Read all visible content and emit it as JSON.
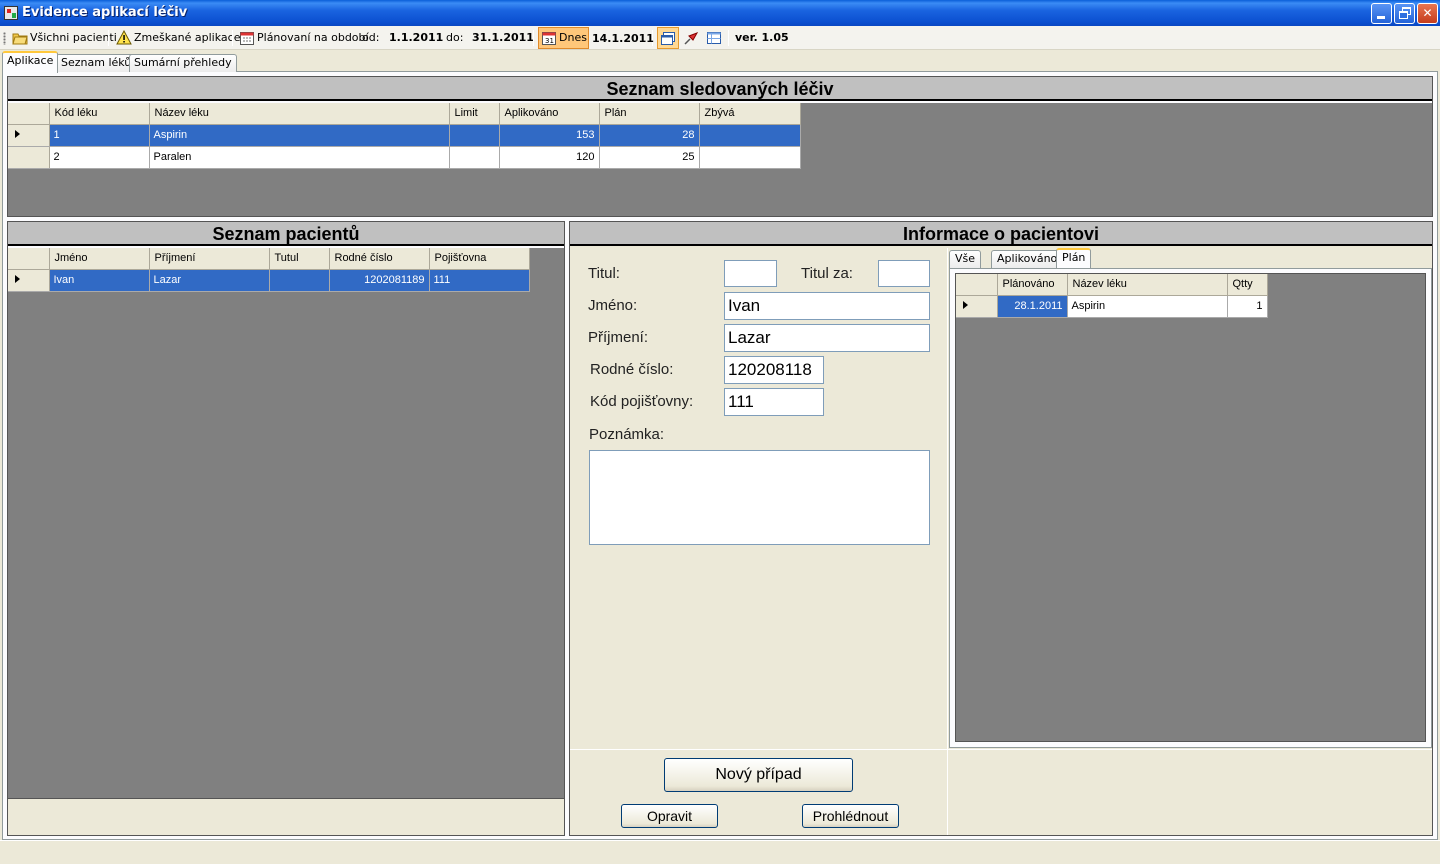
{
  "window": {
    "title": "Evidence aplikací léčiv"
  },
  "toolbar": {
    "all_patients": "Všichni pacienti",
    "missed": "Zmeškané aplikace",
    "planned": "Plánovaní na období",
    "from_label": "od:",
    "from_value": "1.1.2011",
    "to_label": "do:",
    "to_value": "31.1.2011",
    "today_btn": "Dnes",
    "today_value": "14.1.2011",
    "version": "ver. 1.05"
  },
  "tabs": [
    "Aplikace",
    "Seznam léků",
    "Sumární přehledy"
  ],
  "drugs": {
    "title": "Seznam sledovaných léčiv",
    "columns": [
      "Kód léku",
      "Název léku",
      "Limit",
      "Aplikováno",
      "Plán",
      "Zbývá"
    ],
    "rows": [
      {
        "code": "1",
        "name": "Aspirin",
        "limit": "",
        "applied": "153",
        "plan": "28",
        "left": ""
      },
      {
        "code": "2",
        "name": "Paralen",
        "limit": "",
        "applied": "120",
        "plan": "25",
        "left": ""
      }
    ]
  },
  "patients": {
    "title": "Seznam pacientů",
    "columns": [
      "Jméno",
      "Příjmení",
      "Tutul",
      "Rodné číslo",
      "Pojišťovna"
    ],
    "rows": [
      {
        "first": "Ivan",
        "last": "Lazar",
        "title": "",
        "birth": "1202081189",
        "ins": "111"
      }
    ]
  },
  "info": {
    "title": "Informace o pacientovi",
    "titul_label": "Titul:",
    "titul_value": "",
    "titulza_label": "Titul za:",
    "titulza_value": "",
    "first_label": "Jméno:",
    "first_value": "Ivan",
    "last_label": "Příjmení:",
    "last_value": "Lazar",
    "birth_label": "Rodné číslo:",
    "birth_value": "120208118",
    "ins_label": "Kód pojišťovny:",
    "ins_value": "111",
    "note_label": "Poznámka:",
    "note_value": "",
    "new_case": "Nový případ",
    "edit": "Opravit",
    "view": "Prohlédnout",
    "subtabs": [
      "Vše",
      "Aplikováno",
      "Plán"
    ],
    "plan_columns": [
      "Plánováno",
      "Název léku",
      "Qtty"
    ],
    "plan_rows": [
      {
        "date": "28.1.2011",
        "name": "Aspirin",
        "qty": "1"
      }
    ]
  },
  "colors": {
    "selection": "#316ac5",
    "grid_bg": "#808080",
    "panel_header": "#c0c0c0"
  },
  "icons": [
    "app-icon",
    "minimize-icon",
    "restore-icon",
    "close-icon",
    "folder-icon",
    "warning-icon",
    "calendar-icon",
    "calendar-today-icon",
    "window-icon",
    "pin-icon",
    "table-icon",
    "row-arrow-icon"
  ]
}
